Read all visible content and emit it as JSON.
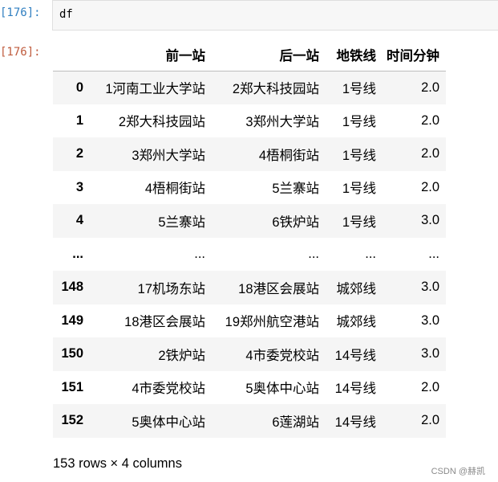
{
  "input_cell": {
    "prompt": "[176]:",
    "code": "df"
  },
  "output_cell": {
    "prompt": "[176]:"
  },
  "dataframe": {
    "columns": [
      "前一站",
      "后一站",
      "地铁线",
      "时间分钟"
    ],
    "rows": [
      {
        "index": "0",
        "cells": [
          "1河南工业大学站",
          "2郑大科技园站",
          "1号线",
          "2.0"
        ]
      },
      {
        "index": "1",
        "cells": [
          "2郑大科技园站",
          "3郑州大学站",
          "1号线",
          "2.0"
        ]
      },
      {
        "index": "2",
        "cells": [
          "3郑州大学站",
          "4梧桐街站",
          "1号线",
          "2.0"
        ]
      },
      {
        "index": "3",
        "cells": [
          "4梧桐街站",
          "5兰寨站",
          "1号线",
          "2.0"
        ]
      },
      {
        "index": "4",
        "cells": [
          "5兰寨站",
          "6铁炉站",
          "1号线",
          "3.0"
        ]
      },
      {
        "index": "...",
        "cells": [
          "...",
          "...",
          "...",
          "..."
        ]
      },
      {
        "index": "148",
        "cells": [
          "17机场东站",
          "18港区会展站",
          "城郊线",
          "3.0"
        ]
      },
      {
        "index": "149",
        "cells": [
          "18港区会展站",
          "19郑州航空港站",
          "城郊线",
          "3.0"
        ]
      },
      {
        "index": "150",
        "cells": [
          "2铁炉站",
          "4市委党校站",
          "14号线",
          "3.0"
        ]
      },
      {
        "index": "151",
        "cells": [
          "4市委党校站",
          "5奥体中心站",
          "14号线",
          "2.0"
        ]
      },
      {
        "index": "152",
        "cells": [
          "5奥体中心站",
          "6莲湖站",
          "14号线",
          "2.0"
        ]
      }
    ],
    "summary": "153 rows × 4 columns"
  },
  "watermark": "CSDN @赫凯",
  "colors": {
    "input_prompt": "#307fc1",
    "output_prompt": "#bf5b3d",
    "input_background": "#f7f7f7",
    "row_stripe": "#f5f5f5"
  }
}
